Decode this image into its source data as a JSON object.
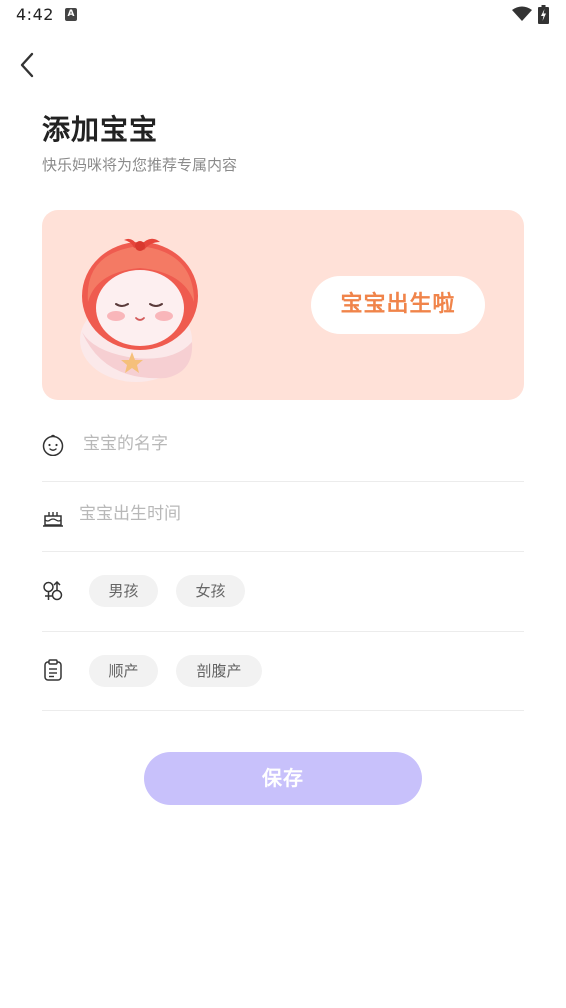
{
  "status_bar": {
    "time": "4:42",
    "notification_letter": "A"
  },
  "header": {
    "title": "添加宝宝",
    "subtitle": "快乐妈咪将为您推荐专属内容"
  },
  "banner": {
    "button_label": "宝宝出生啦",
    "background_color": "#ffe1d8",
    "accent_color": "#f0844a"
  },
  "form": {
    "name": {
      "placeholder": "宝宝的名字",
      "value": ""
    },
    "birth_time": {
      "placeholder": "宝宝出生时间",
      "value": ""
    },
    "gender": {
      "options": [
        "男孩",
        "女孩"
      ]
    },
    "delivery": {
      "options": [
        "顺产",
        "剖腹产"
      ]
    }
  },
  "actions": {
    "save_label": "保存",
    "save_color": "#c8c1fb"
  },
  "icons": {
    "name_row": "baby-face-icon",
    "birth_row": "cake-icon",
    "gender_row": "gender-icon",
    "delivery_row": "clipboard-icon"
  }
}
